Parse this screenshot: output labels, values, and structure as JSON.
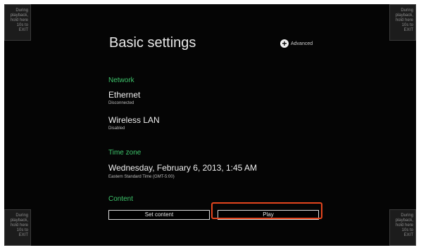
{
  "corner_text": "During\nplayback,\nhold here\n10s to EXIT",
  "title": "Basic settings",
  "advanced_label": "Advanced",
  "advanced_icon": "plus-circle-icon",
  "network": {
    "header": "Network",
    "ethernet": {
      "title": "Ethernet",
      "status": "Disconnected"
    },
    "wireless": {
      "title": "Wireless LAN",
      "status": "Disabled"
    }
  },
  "timezone": {
    "header": "Time zone",
    "datetime": "Wednesday, February 6, 2013, 1:45 AM",
    "zone": "Eastern Standard Time (GMT-5:00)"
  },
  "content": {
    "header": "Content",
    "set_content_label": "Set content",
    "play_label": "Play"
  },
  "colors": {
    "background": "#050505",
    "section_header": "#3ec46b",
    "highlight": "#e3451e"
  }
}
